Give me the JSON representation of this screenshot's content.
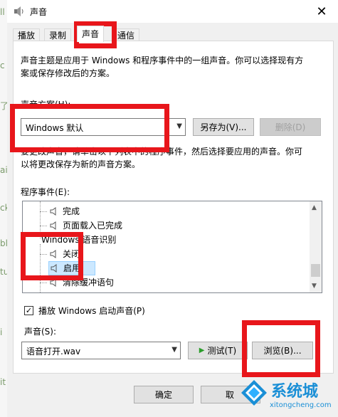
{
  "window": {
    "title": "声音",
    "close_glyph": "✕"
  },
  "tabs": [
    {
      "label": "播放"
    },
    {
      "label": "录制"
    },
    {
      "label": "声音",
      "active": true
    },
    {
      "label": "通信"
    }
  ],
  "sounds_tab": {
    "description": [
      "声音主题是应用于 Windows 和程序事件中的一组声音。你可以选择现有方",
      "案或保存修改后的方案。"
    ],
    "scheme_label": "声音方案(H):",
    "scheme_value": "Windows 默认",
    "save_as_label": "另存为(V)...",
    "delete_label": "删除(D)",
    "instructions": [
      "要更改声音，请单击以下列表中的程序事件，然后选择要应用的声音。你可",
      "以将更改保存为新的声音方案。"
    ],
    "program_events_label": "程序事件(E):",
    "events": [
      {
        "label": "完成",
        "level": 1
      },
      {
        "label": "页面载入已完成",
        "level": 1
      },
      {
        "label": "Windows 语音识别",
        "level": 0
      },
      {
        "label": "关闭",
        "level": 1
      },
      {
        "label": "启用",
        "level": 1,
        "selected": true
      },
      {
        "label": "清除缓冲语句",
        "level": 1
      }
    ],
    "startup_checkbox_label": "播放 Windows 启动声音(P)",
    "startup_checked": true,
    "sounds_label": "声音(S):",
    "sound_value": "语音打开.wav",
    "test_label": "测试(T)",
    "browse_label": "浏览(B)..."
  },
  "footer": {
    "ok_label": "确定",
    "cancel_label": "取"
  },
  "watermark": {
    "brand": "系统城",
    "url": "xitongcheng.com"
  },
  "highlight_color": "#e8161b",
  "accent": "#0078d7",
  "left_strip_chars": [
    "ll",
    "c",
    "了",
    "ai",
    "ck",
    "bl",
    "tu",
    "i",
    "it"
  ]
}
